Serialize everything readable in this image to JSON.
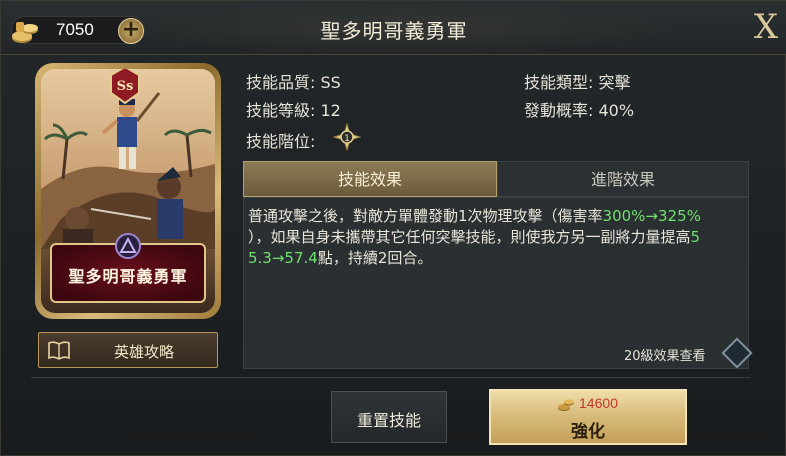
{
  "header": {
    "currency_amount": "7050",
    "plus_label": "+",
    "title": "聖多明哥義勇軍",
    "close_label": "X"
  },
  "card": {
    "name": "聖多明哥義勇軍",
    "rank_badge": "Ss"
  },
  "guide_button": {
    "label": "英雄攻略"
  },
  "info": {
    "quality": "技能品質: SS",
    "level": "技能等級: 12",
    "stage": "技能階位:",
    "type": "技能類型: 突擊",
    "chance": "發動概率: 40%",
    "stage_value": "1"
  },
  "tabs": {
    "active": "技能效果",
    "inactive": "進階效果"
  },
  "effect": {
    "line1_a": "普通攻擊之後，對敵方單體發動1次物理攻擊（傷害率",
    "line1_hl": "300%→325%",
    "line2_a": "），如果自身未攜帶其它任何突擊技能，則使我方另一副將力量提高",
    "line2_hl": "5",
    "line3_hl": "5.3→57.4",
    "line3_b": "點，持續2回合。",
    "lv20_label": "20級效果查看"
  },
  "buttons": {
    "reset_label": "重置技能",
    "upgrade_cost": "14600",
    "upgrade_label": "強化"
  },
  "colors": {
    "highlight": "#6ee06e",
    "cost_red": "#c0392b",
    "gold": "#d6b978"
  },
  "icons": {
    "currency": "coin-pile-icon",
    "guide": "book-icon",
    "stage": "compass-star-icon",
    "class": "triangle-class-icon"
  }
}
